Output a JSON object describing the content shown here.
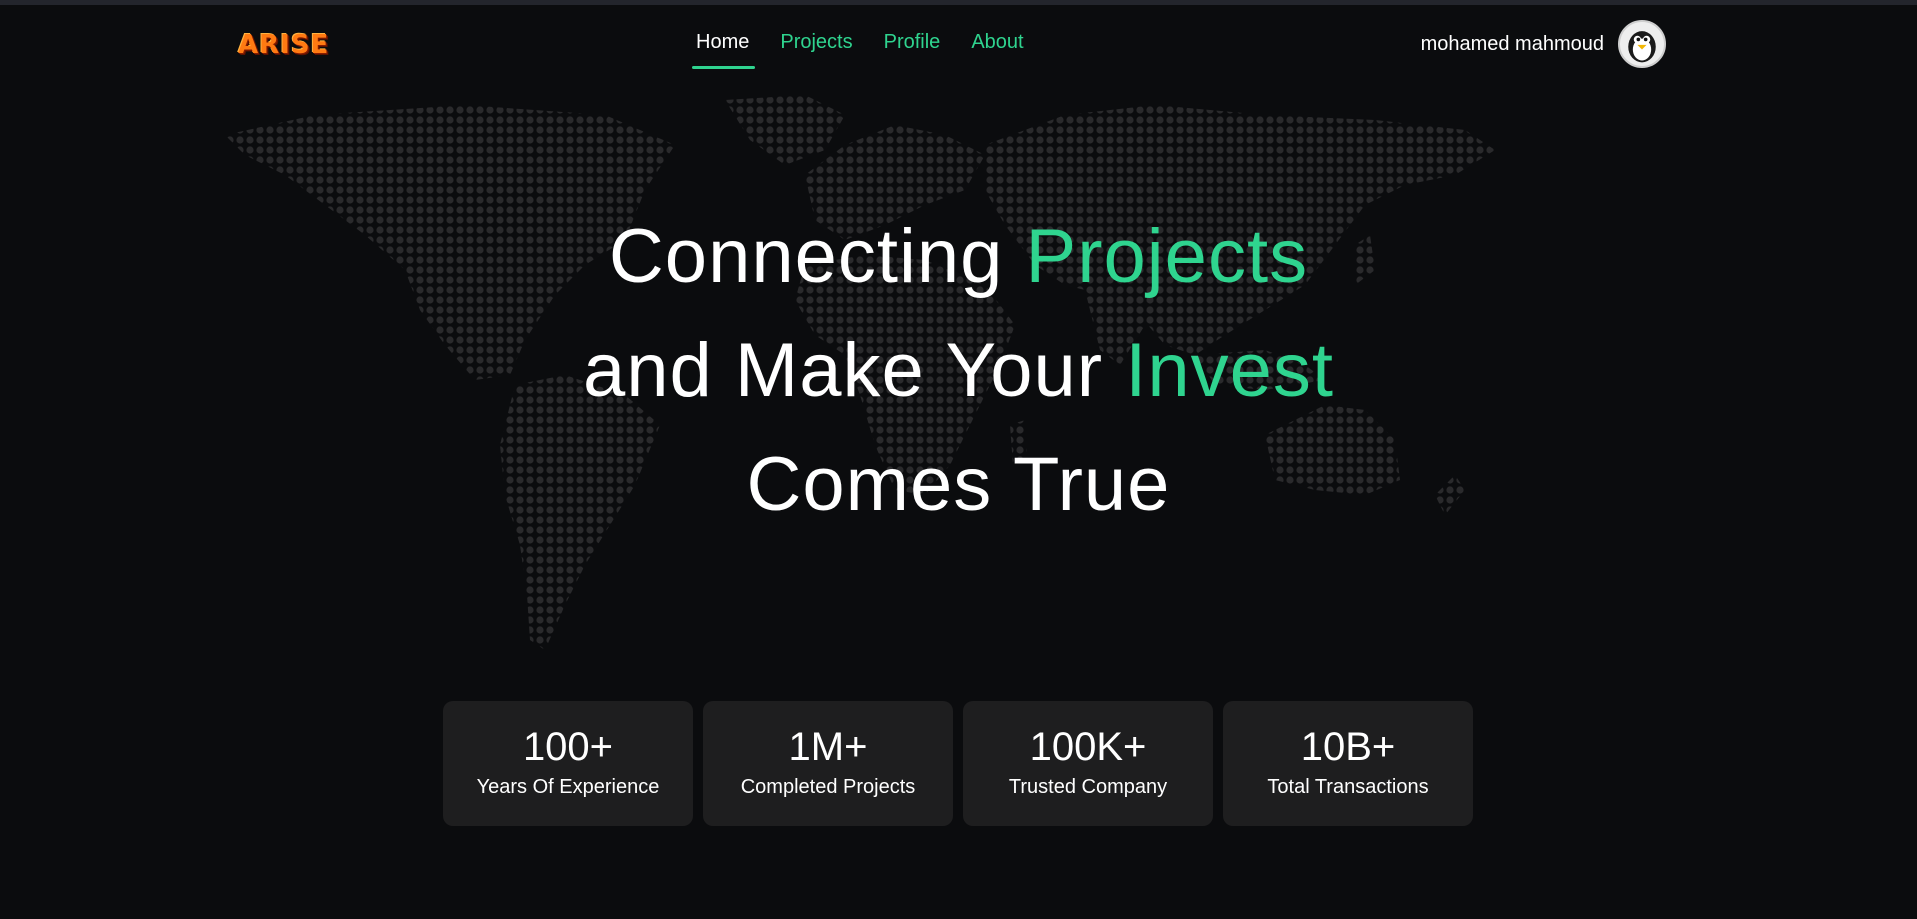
{
  "brand": {
    "logo_text": "ARISE"
  },
  "nav": {
    "items": [
      {
        "label": "Home",
        "active": true
      },
      {
        "label": "Projects",
        "active": false
      },
      {
        "label": "Profile",
        "active": false
      },
      {
        "label": "About",
        "active": false
      }
    ]
  },
  "user": {
    "name": "mohamed mahmoud",
    "avatar_icon": "penguin-icon"
  },
  "hero": {
    "line1_a": "Connecting ",
    "line1_b": "Projects",
    "line2_a": "and Make Your ",
    "line2_b": "Invest",
    "line3": "Comes True"
  },
  "stats": [
    {
      "value": "100+",
      "label": "Years Of Experience"
    },
    {
      "value": "1M+",
      "label": "Completed Projects"
    },
    {
      "value": "100K+",
      "label": "Trusted Company"
    },
    {
      "value": "10B+",
      "label": "Total Transactions"
    }
  ],
  "colors": {
    "background": "#0b0c0e",
    "accent": "#2fd48f",
    "card": "#1e1e1f",
    "map_dot": "#2a2a2c"
  }
}
